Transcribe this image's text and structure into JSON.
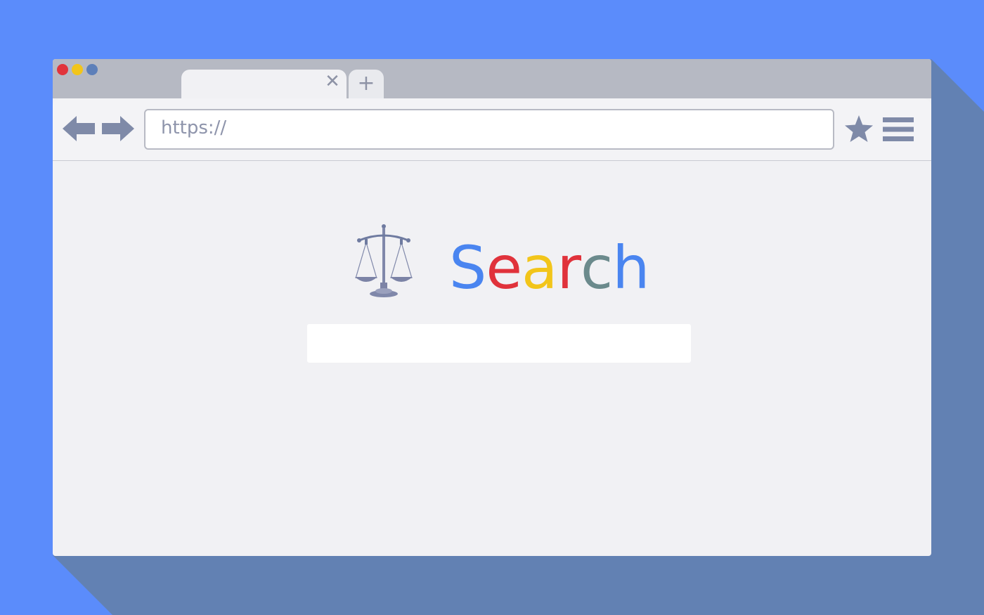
{
  "colors": {
    "background": "#5b8cfb",
    "shadow": "#6281b3",
    "window": "#f1f1f4",
    "titlebar": "#b6b9c3",
    "icon": "#7f8aa8"
  },
  "window_controls": {
    "close": "#e1343c",
    "minimize": "#f2c51a",
    "maximize": "#5d7fb9"
  },
  "tab": {
    "title": "",
    "close_icon": "close-icon",
    "new_tab_icon": "plus-icon"
  },
  "toolbar": {
    "back_icon": "arrow-left-icon",
    "forward_icon": "arrow-right-icon",
    "url": "https://",
    "bookmark_icon": "star-icon",
    "menu_icon": "hamburger-menu-icon"
  },
  "page": {
    "logo_icon": "scales-of-justice-icon",
    "brand_letters": [
      {
        "char": "S",
        "color": "#4a85f0"
      },
      {
        "char": "e",
        "color": "#e0323b"
      },
      {
        "char": "a",
        "color": "#f2c51a"
      },
      {
        "char": "r",
        "color": "#e0323b"
      },
      {
        "char": "c",
        "color": "#6b8a8c"
      },
      {
        "char": "h",
        "color": "#4a85f0"
      }
    ],
    "search_value": ""
  }
}
